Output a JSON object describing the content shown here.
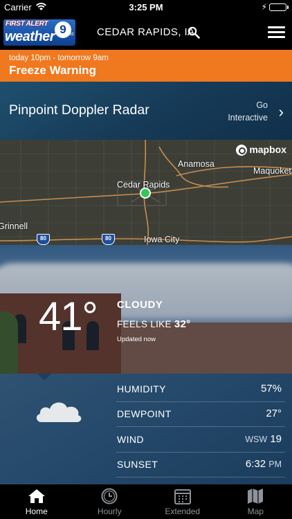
{
  "status_bar": {
    "carrier": "Carrier",
    "time": "3:25 PM"
  },
  "header": {
    "logo_text_top": "FIRST ALERT",
    "logo_text_main": "weather",
    "logo_channel": "9",
    "logo_network": "abc",
    "location": "CEDAR RAPIDS, IA"
  },
  "alert": {
    "timeframe": "today 10pm - tomorrow 9am",
    "title": "Freeze Warning",
    "color": "#f0781e"
  },
  "radar": {
    "title": "Pinpoint Doppler Radar",
    "go_line1": "Go",
    "go_line2": "Interactive"
  },
  "map": {
    "attribution": "mapbox",
    "places": [
      "Anamosa",
      "Maquoketa",
      "Cedar Rapids",
      "Grinnell",
      "Iowa City"
    ],
    "highways": [
      "80",
      "80"
    ]
  },
  "current": {
    "temperature": "41°",
    "condition": "CLOUDY",
    "feels_like_label": "FEELS LIKE",
    "feels_like_value": "32°",
    "updated": "Updated now"
  },
  "details": [
    {
      "label": "HUMIDITY",
      "value": "57%",
      "unit": ""
    },
    {
      "label": "DEWPOINT",
      "value": "27°",
      "unit": ""
    },
    {
      "label": "WIND",
      "value": "19",
      "unit": "WSW"
    },
    {
      "label": "SUNSET",
      "value": "6:32",
      "unit": "PM"
    }
  ],
  "tabs": [
    {
      "label": "Home",
      "icon": "home-icon",
      "active": true
    },
    {
      "label": "Hourly",
      "icon": "clock-icon",
      "active": false
    },
    {
      "label": "Extended",
      "icon": "calendar-icon",
      "active": false
    },
    {
      "label": "Map",
      "icon": "map-icon",
      "active": false
    }
  ]
}
